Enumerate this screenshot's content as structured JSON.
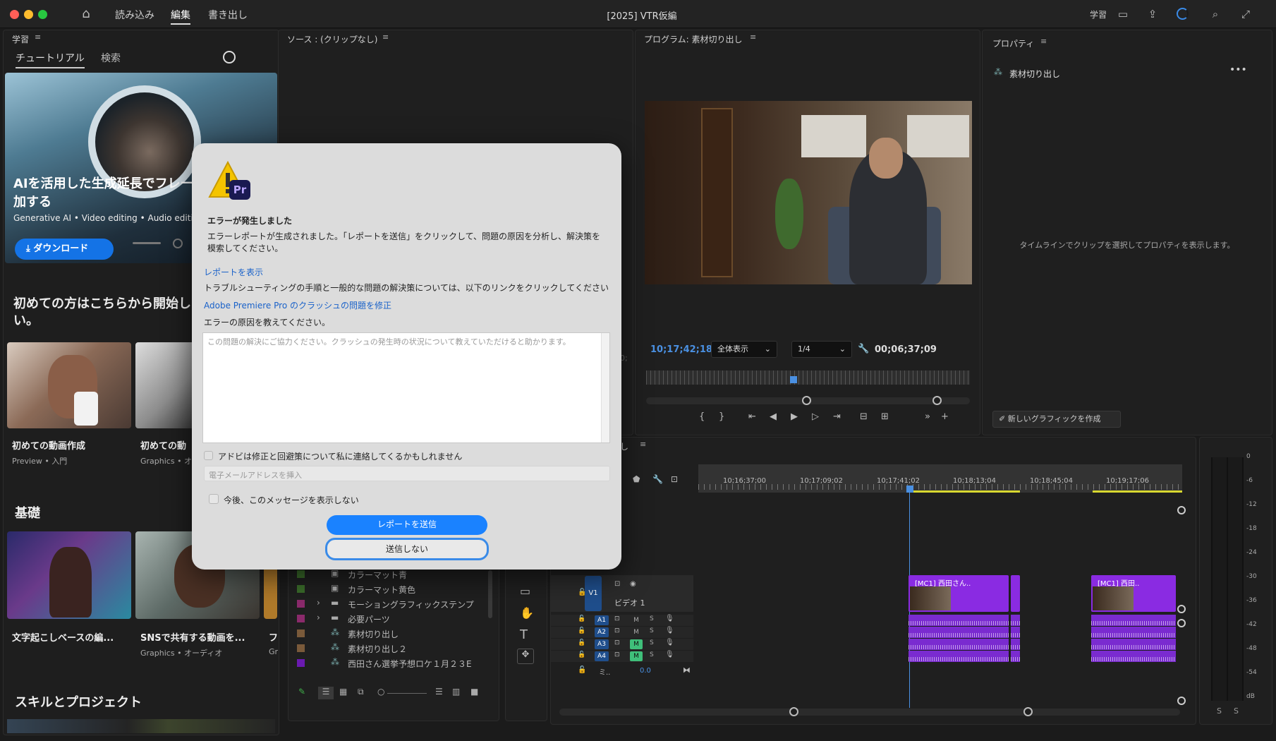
{
  "titlebar": {
    "menu": [
      "読み込み",
      "編集",
      "書き出し"
    ],
    "active_menu": "編集",
    "title": "[2025] VTR仮編",
    "learn_label": "学習",
    "icons": [
      "home-icon",
      "layout-icon",
      "share-icon",
      "progress-ring-icon",
      "search-icon",
      "fullscreen-icon"
    ]
  },
  "learn": {
    "panel_title": "学習",
    "tabs": [
      "チュートリアル",
      "検索"
    ],
    "hero": {
      "title": "AIを活用した生成延長でフレー加する",
      "tags": "Generative AI • Video editing • Audio editin",
      "download": "ダウンロード"
    },
    "section_start": "初めての方はこちらから開始しい。",
    "start_cards": [
      {
        "title": "初めての動画作成",
        "sub": "Preview • 入門"
      },
      {
        "title": "初めての動",
        "sub": "Graphics • オー"
      }
    ],
    "section_basics": "基礎",
    "basic_cards": [
      {
        "title": "文字起こしベースの編...",
        "sub": ""
      },
      {
        "title": "SNSで共有する動画を...",
        "sub": "Graphics • オーディオ"
      },
      {
        "title": "フ",
        "sub": "Gr"
      }
    ],
    "section_skills": "スキルとプロジェクト"
  },
  "source": {
    "panel_title": "ソース : (クリップなし)",
    "project_items": [
      {
        "name": "カラーマット青",
        "color": "#3a6b2a",
        "type": "matte"
      },
      {
        "name": "カラーマット黄色",
        "color": "#3a6b2a",
        "type": "matte"
      },
      {
        "name": "モーショングラフィックステンプ",
        "color": "#8b2a6b",
        "type": "folder"
      },
      {
        "name": "必要パーツ",
        "color": "#8b2a6b",
        "type": "folder"
      },
      {
        "name": "素材切り出し",
        "color": "#7a5a3a",
        "type": "sequence"
      },
      {
        "name": "素材切り出し２",
        "color": "#7a5a3a",
        "type": "sequence"
      },
      {
        "name": "西田さん選挙予想ロケ１月２３E",
        "color": "#6a1ab0",
        "type": "sequence"
      }
    ]
  },
  "program": {
    "panel_title": "プログラム: 素材切り出し",
    "timecode": "10;17;42;18",
    "fit": "全体表示",
    "quality": "1/4",
    "duration": "00;06;37;09"
  },
  "properties": {
    "panel_title": "プロパティ",
    "sequence": "素材切り出し",
    "hint": "タイムラインでクリップを選択してプロパティを表示します。",
    "new_graphic": "新しいグラフィックを作成"
  },
  "timeline": {
    "tab_suffix": "し",
    "ruler": [
      "10;16;37;00",
      "10;17;09;02",
      "10;17;41;02",
      "10;18;13;04",
      "10;18;45;04",
      "10;19;17;06"
    ],
    "v1_label": "V1",
    "video_track": "ビデオ 1",
    "audio_tracks": [
      "A1",
      "A2",
      "A3",
      "A4"
    ],
    "mix_label": "ミ..",
    "mix_value": "0.0",
    "clip_labels": [
      "[MC1] 西田さん..",
      "[MC1] 西田.."
    ],
    "meter_scale": [
      "0",
      "-6",
      "-12",
      "-18",
      "-24",
      "-30",
      "-36",
      "-42",
      "-48",
      "-54",
      "dB"
    ],
    "meter_bottom": [
      "S",
      "S"
    ]
  },
  "dialog": {
    "heading": "エラーが発生しました",
    "message": "エラーレポートが生成されました。「レポートを送信」をクリックして、問題の原因を分析し、解決策を模索してください。",
    "show_report": "レポートを表示",
    "trouble_text": "トラブルシューティングの手順と一般的な問題の解決策については、以下のリンクをクリックしてください",
    "crash_link": "Adobe Premiere Pro のクラッシュの問題を修正",
    "cause_label": "エラーの原因を教えてください。",
    "textarea_placeholder": "この問題の解決にご協力ください。クラッシュの発生時の状況について教えていただけると助かります。",
    "contact_checkbox": "アドビは修正と回避策について私に連絡してくるかもしれません",
    "email_placeholder": "電子メールアドレスを挿入",
    "dont_show": "今後、このメッセージを表示しない",
    "send_button": "レポートを送信",
    "cancel_button": "送信しない",
    "app_badge": "Pr"
  }
}
